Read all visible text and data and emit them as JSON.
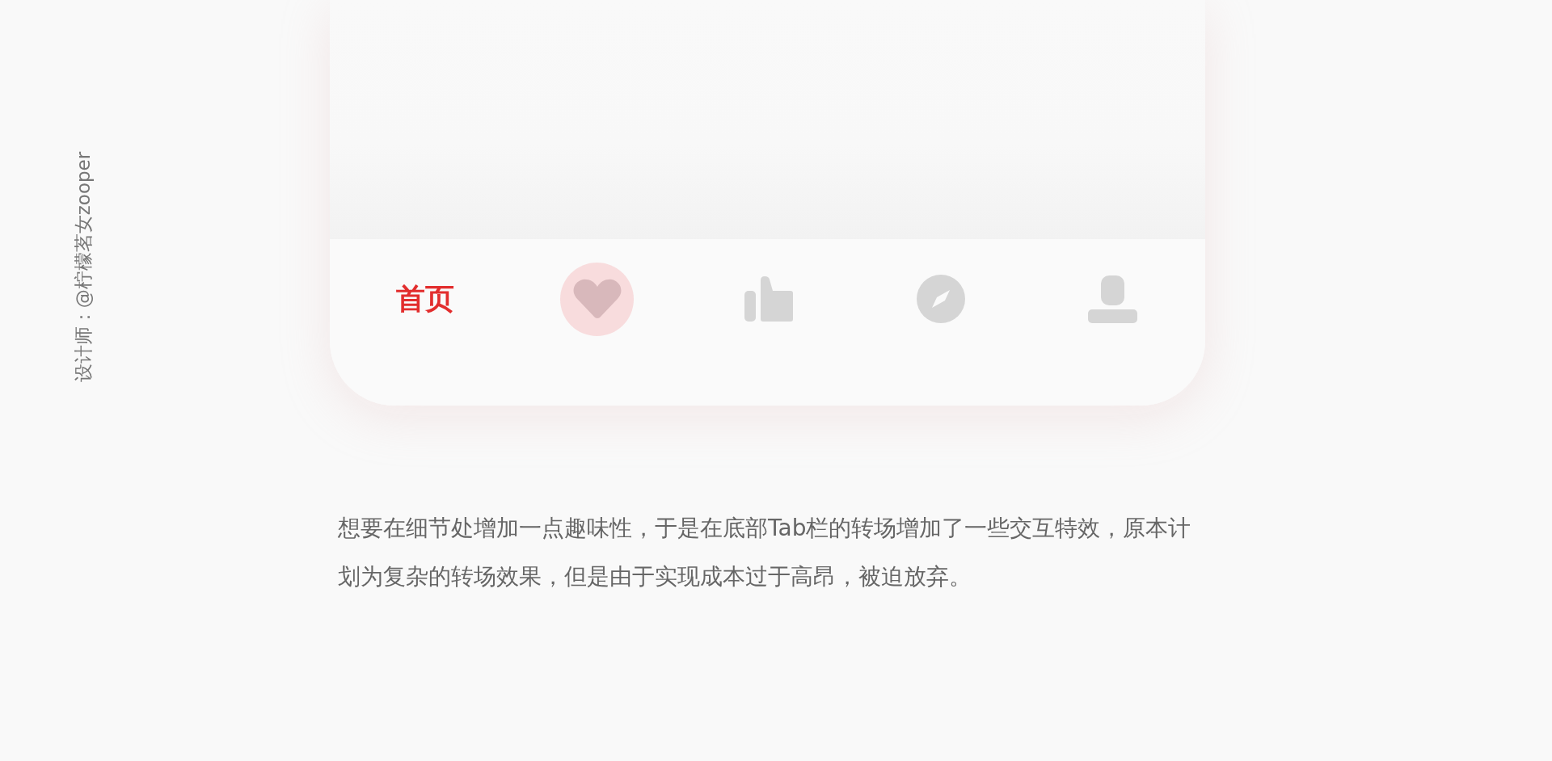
{
  "designer_credit": "设计师：@柠檬茗女zooper",
  "tab_bar": {
    "tabs": [
      {
        "kind": "label",
        "label": "首页",
        "selected": true,
        "highlighted": false
      },
      {
        "kind": "icon",
        "selected": false,
        "highlighted": true
      },
      {
        "kind": "icon",
        "selected": false,
        "highlighted": false
      },
      {
        "kind": "icon",
        "selected": false,
        "highlighted": false
      },
      {
        "kind": "icon",
        "selected": false,
        "highlighted": false
      }
    ]
  },
  "description": "想要在细节处增加一点趣味性，于是在底部Tab栏的转场增加了一些交互特效，原本计划为复杂的转场效果，但是由于实现成本过于高昂，被迫放弃。"
}
